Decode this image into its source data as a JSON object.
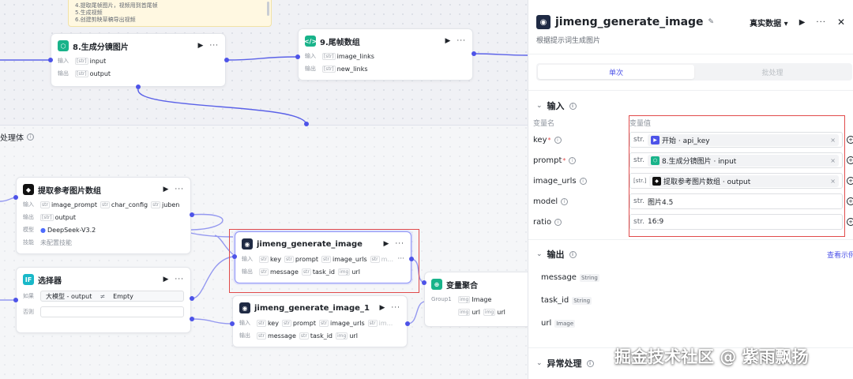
{
  "note": {
    "lines": [
      "4.提取尾帧图片，视频用到首尾帧",
      "5.生成视频",
      "6.创建剪映草稿导出视频"
    ]
  },
  "group": {
    "title": "处理体"
  },
  "nodes": {
    "storyboard": {
      "title": "8.生成分镜图片",
      "input_label": "输入",
      "output_label": "输出",
      "input": "input",
      "output": "output",
      "type_tag": "[str]"
    },
    "tailframes": {
      "title": "9.尾帧数组",
      "input_label": "输入",
      "output_label": "输出",
      "input": "image_links",
      "output": "new_links",
      "type_tag": "[str]"
    },
    "extract": {
      "title": "提取参考图片数组",
      "input_label": "输入",
      "output_label": "输出",
      "model_label": "模型",
      "skill_label": "技能",
      "inputs": [
        "image_prompt",
        "char_config",
        "juben"
      ],
      "output": "output",
      "model": "DeepSeek-V3.2",
      "skill": "未配置技能",
      "tag_str": "str",
      "tag_arr": "[str]"
    },
    "gen1": {
      "title": "jimeng_generate_image",
      "input_label": "输入",
      "output_label": "输出",
      "inputs": [
        "key",
        "prompt",
        "image_urls",
        "m..."
      ],
      "outputs": [
        "message",
        "task_id",
        "url"
      ],
      "tag_str": "str",
      "tag_img": "img"
    },
    "gen2": {
      "title": "jimeng_generate_image_1",
      "input_label": "输入",
      "output_label": "输出",
      "inputs": [
        "key",
        "prompt",
        "image_urls",
        "im..."
      ],
      "outputs": [
        "message",
        "task_id",
        "url"
      ],
      "tag_str": "str",
      "tag_img": "img"
    },
    "selector": {
      "title": "选择器",
      "if_label": "如果",
      "else_label": "否则",
      "left": "大模型 - output",
      "op": "≠",
      "right": "Empty"
    },
    "aggregate": {
      "title": "变量聚合",
      "group_label": "Group1",
      "items": [
        "Image",
        "url",
        "url"
      ]
    }
  },
  "panel": {
    "title": "jimeng_generate_image",
    "subtitle": "根据提示词生成图片",
    "data_mode": "真实数据",
    "tabs": [
      {
        "label": "单次"
      },
      {
        "label": "批处理"
      }
    ],
    "input_section": "输入",
    "col_name": "变量名",
    "col_value": "变量值",
    "vars": [
      {
        "name": "key",
        "required": true,
        "type": "str.",
        "ref": "开始 · api_key",
        "icon_color": "#4d53e8"
      },
      {
        "name": "prompt",
        "required": true,
        "type": "str.",
        "ref": "8.生成分镜图片 · input",
        "icon_color": "#19b38a"
      },
      {
        "name": "image_urls",
        "required": false,
        "type": "[str.]",
        "ref": "提取参考图片数组 · output",
        "icon_color": "#111111"
      },
      {
        "name": "model",
        "required": false,
        "type": "str.",
        "value": "图片4.5"
      },
      {
        "name": "ratio",
        "required": false,
        "type": "str.",
        "value": "16:9"
      }
    ],
    "output_section": "输出",
    "view_sample": "查看示例",
    "outputs": [
      {
        "name": "message",
        "type": "String"
      },
      {
        "name": "task_id",
        "type": "String"
      },
      {
        "name": "url",
        "type": "Image"
      }
    ],
    "error_section": "异常处理"
  },
  "watermark": "掘金技术社区 @ 紫雨飘扬",
  "colors": {
    "accent": "#4d53e8",
    "highlight": "#e14b4b",
    "code_icon": "#19b38a"
  }
}
